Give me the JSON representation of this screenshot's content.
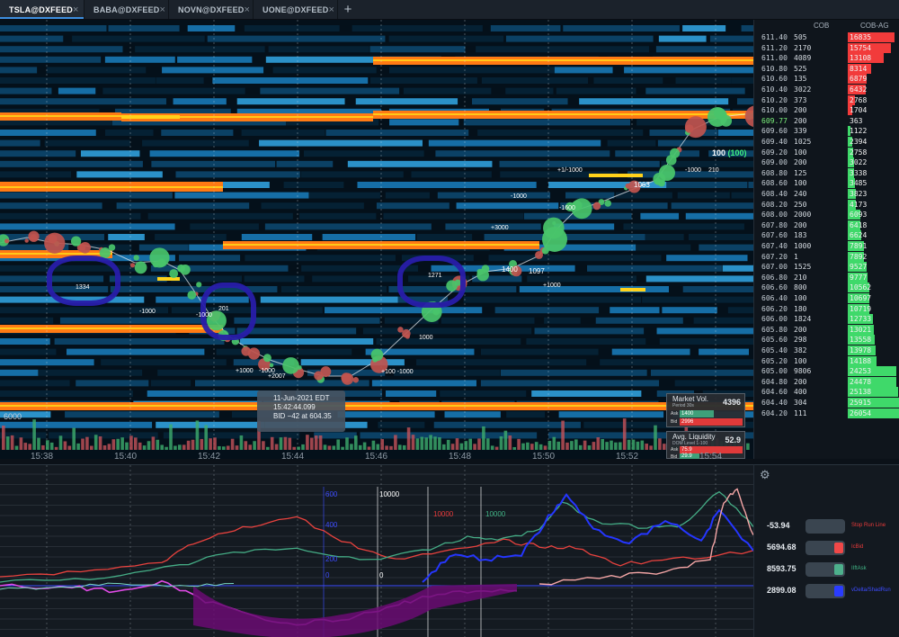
{
  "tabs": [
    {
      "label": "TSLA@DXFEED",
      "active": true
    },
    {
      "label": "BABA@DXFEED",
      "active": false
    },
    {
      "label": "NOVN@DXFEED",
      "active": false
    },
    {
      "label": "UONE@DXFEED",
      "active": false
    }
  ],
  "tab_close_glyph": "×",
  "tab_add_glyph": "+",
  "ladder": {
    "col_cob": "COB",
    "col_cobag": "COB-AG",
    "rows": [
      {
        "price": "611.40",
        "cob": "505",
        "cobag": "16835",
        "side": "ask"
      },
      {
        "price": "611.20",
        "cob": "2170",
        "cobag": "15754",
        "side": "ask"
      },
      {
        "price": "611.00",
        "cob": "4089",
        "cobag": "13108",
        "side": "ask"
      },
      {
        "price": "610.80",
        "cob": "525",
        "cobag": "8314",
        "side": "ask"
      },
      {
        "price": "610.60",
        "cob": "135",
        "cobag": "6879",
        "side": "ask"
      },
      {
        "price": "610.40",
        "cob": "3022",
        "cobag": "6432",
        "side": "ask"
      },
      {
        "price": "610.20",
        "cob": "373",
        "cobag": "2768",
        "side": "ask"
      },
      {
        "price": "610.00",
        "cob": "200",
        "cobag": "1704",
        "side": "ask"
      },
      {
        "price": "609.77",
        "cob": "200",
        "cobag": "363",
        "side": "cur"
      },
      {
        "price": "609.60",
        "cob": "339",
        "cobag": "1122",
        "side": "bid"
      },
      {
        "price": "609.40",
        "cob": "1025",
        "cobag": "2394",
        "side": "bid"
      },
      {
        "price": "609.20",
        "cob": "100",
        "cobag": "2758",
        "side": "bid"
      },
      {
        "price": "609.00",
        "cob": "200",
        "cobag": "3022",
        "side": "bid"
      },
      {
        "price": "608.80",
        "cob": "125",
        "cobag": "3338",
        "side": "bid"
      },
      {
        "price": "608.60",
        "cob": "100",
        "cobag": "3485",
        "side": "bid"
      },
      {
        "price": "608.40",
        "cob": "240",
        "cobag": "3823",
        "side": "bid"
      },
      {
        "price": "608.20",
        "cob": "250",
        "cobag": "4173",
        "side": "bid"
      },
      {
        "price": "608.00",
        "cob": "2000",
        "cobag": "6093",
        "side": "bid"
      },
      {
        "price": "607.80",
        "cob": "200",
        "cobag": "6418",
        "side": "bid"
      },
      {
        "price": "607.60",
        "cob": "183",
        "cobag": "6624",
        "side": "bid"
      },
      {
        "price": "607.40",
        "cob": "1000",
        "cobag": "7891",
        "side": "bid"
      },
      {
        "price": "607.20",
        "cob": "1",
        "cobag": "7892",
        "side": "bid"
      },
      {
        "price": "607.00",
        "cob": "1525",
        "cobag": "9527",
        "side": "bid"
      },
      {
        "price": "606.80",
        "cob": "210",
        "cobag": "9777",
        "side": "bid"
      },
      {
        "price": "606.60",
        "cob": "800",
        "cobag": "10562",
        "side": "bid"
      },
      {
        "price": "606.40",
        "cob": "100",
        "cobag": "10697",
        "side": "bid"
      },
      {
        "price": "606.20",
        "cob": "180",
        "cobag": "10719",
        "side": "bid"
      },
      {
        "price": "606.00",
        "cob": "1824",
        "cobag": "12733",
        "side": "bid"
      },
      {
        "price": "605.80",
        "cob": "200",
        "cobag": "13021",
        "side": "bid"
      },
      {
        "price": "605.60",
        "cob": "298",
        "cobag": "13558",
        "side": "bid"
      },
      {
        "price": "605.40",
        "cob": "382",
        "cobag": "13978",
        "side": "bid"
      },
      {
        "price": "605.20",
        "cob": "100",
        "cobag": "14188",
        "side": "bid"
      },
      {
        "price": "605.00",
        "cob": "9806",
        "cobag": "24253",
        "side": "bid"
      },
      {
        "price": "604.80",
        "cob": "200",
        "cobag": "24478",
        "side": "bid"
      },
      {
        "price": "604.60",
        "cob": "400",
        "cobag": "25138",
        "side": "bid"
      },
      {
        "price": "604.40",
        "cob": "304",
        "cobag": "25915",
        "side": "bid"
      },
      {
        "price": "604.20",
        "cob": "111",
        "cobag": "26054",
        "side": "bid"
      }
    ]
  },
  "time_axis": [
    "15:38",
    "15:40",
    "15:42",
    "15:44",
    "15:46",
    "15:48",
    "15:50",
    "15:52",
    "15:54"
  ],
  "volume_axis_label": "6000",
  "current_price_tag": {
    "value": "100",
    "paren": "(100)",
    "below": "210"
  },
  "tooltip": {
    "line1": "11-Jun-2021 EDT",
    "line2": "15:42:44.099",
    "line3": "BID −42 at 604.35"
  },
  "market_vol": {
    "title": "Market Vol.",
    "sub": "Period 30s",
    "value": "4396",
    "ask_label": "Ask",
    "ask": "1400",
    "bid_label": "Bid",
    "bid": "2996"
  },
  "avg_liquidity": {
    "title": "Avg. Liquidity",
    "sub": "DOM Level 1-100",
    "value": "52.9",
    "ask_label": "Ask",
    "ask": "75.9",
    "bid_label": "Bid",
    "bid": "29.9"
  },
  "trade_labels": [
    {
      "text": "1334"
    },
    {
      "text": "201"
    },
    {
      "text": "1271"
    },
    {
      "text": "1400"
    },
    {
      "text": "1097"
    },
    {
      "text": "1000"
    },
    {
      "text": "1063"
    },
    {
      "text": "-1000"
    },
    {
      "text": "+3000"
    },
    {
      "text": "+1000"
    },
    {
      "text": "-1000"
    },
    {
      "text": "+1000"
    },
    {
      "text": "-1000"
    },
    {
      "text": "+2007"
    },
    {
      "text": "+100 -1000"
    },
    {
      "text": "-1600"
    },
    {
      "text": "+1/-1000"
    },
    {
      "text": "-1000"
    },
    {
      "text": "-1000"
    }
  ],
  "lower_labels": {
    "a": "600",
    "b": "10000",
    "c": "10000",
    "d": "10000",
    "e": "400",
    "f": "200",
    "g": "0",
    "h": "0"
  },
  "indicators": [
    {
      "value": "-53.94",
      "name": "Stop Run Line",
      "color": "#e83a3a",
      "swatch": "#3a4550"
    },
    {
      "value": "5694.68",
      "name": "IcBid",
      "color": "#e83a3a",
      "swatch": "#f04848"
    },
    {
      "value": "8593.75",
      "name": "IIftAsk",
      "color": "#41b486",
      "swatch": "#4db08c"
    },
    {
      "value": "2899.08",
      "name": "vDelta/ShadRun",
      "color": "#3d4cff",
      "swatch": "#2a3cff"
    }
  ],
  "colors": {
    "orange": "#ff7a14",
    "yellow": "#ffd21a",
    "bid_green": "#3fd96a",
    "ask_red": "#f23b3b",
    "heat_blue": "#1a7fc0"
  }
}
